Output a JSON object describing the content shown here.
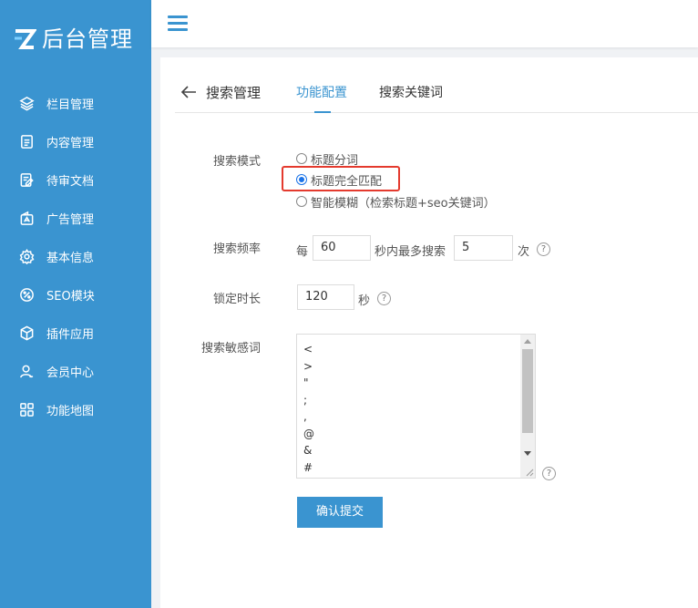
{
  "brand": {
    "title": "后台管理",
    "logo_letter": "Z"
  },
  "sidebar": {
    "items": [
      {
        "label": "栏目管理",
        "icon": "layers-icon"
      },
      {
        "label": "内容管理",
        "icon": "document-icon"
      },
      {
        "label": "待审文档",
        "icon": "edit-document-icon"
      },
      {
        "label": "广告管理",
        "icon": "ad-icon"
      },
      {
        "label": "基本信息",
        "icon": "gear-icon"
      },
      {
        "label": "SEO模块",
        "icon": "seo-icon"
      },
      {
        "label": "插件应用",
        "icon": "cube-icon"
      },
      {
        "label": "会员中心",
        "icon": "user-icon"
      },
      {
        "label": "功能地图",
        "icon": "grid-icon"
      }
    ]
  },
  "header": {
    "menu_icon": "hamburger-icon"
  },
  "tabs": {
    "back_label": "搜索管理",
    "items": [
      {
        "label": "功能配置",
        "active": true
      },
      {
        "label": "搜索关键词",
        "active": false
      }
    ]
  },
  "form": {
    "search_mode": {
      "label": "搜索模式",
      "options": [
        {
          "label": "标题分词",
          "checked": false
        },
        {
          "label": "标题完全匹配",
          "checked": true
        },
        {
          "label": "智能模糊（检索标题+seo关键词）",
          "checked": false
        }
      ]
    },
    "frequency": {
      "label": "搜索频率",
      "prefix": "每",
      "seconds_value": "60",
      "middle": "秒内最多搜索",
      "count_value": "5",
      "suffix": "次"
    },
    "lock_time": {
      "label": "锁定时长",
      "value": "120",
      "unit": "秒"
    },
    "sensitive_words": {
      "label": "搜索敏感词",
      "lines": [
        "<",
        ">",
        "\"",
        ";",
        ",",
        "@",
        "&",
        "#",
        "\\"
      ]
    },
    "help_symbol": "?",
    "submit_label": "确认提交"
  },
  "colors": {
    "sidebar": "#3a94d0",
    "accent": "#3a94d0",
    "highlight": "#e43a2e",
    "radio": "#1a73e8"
  }
}
